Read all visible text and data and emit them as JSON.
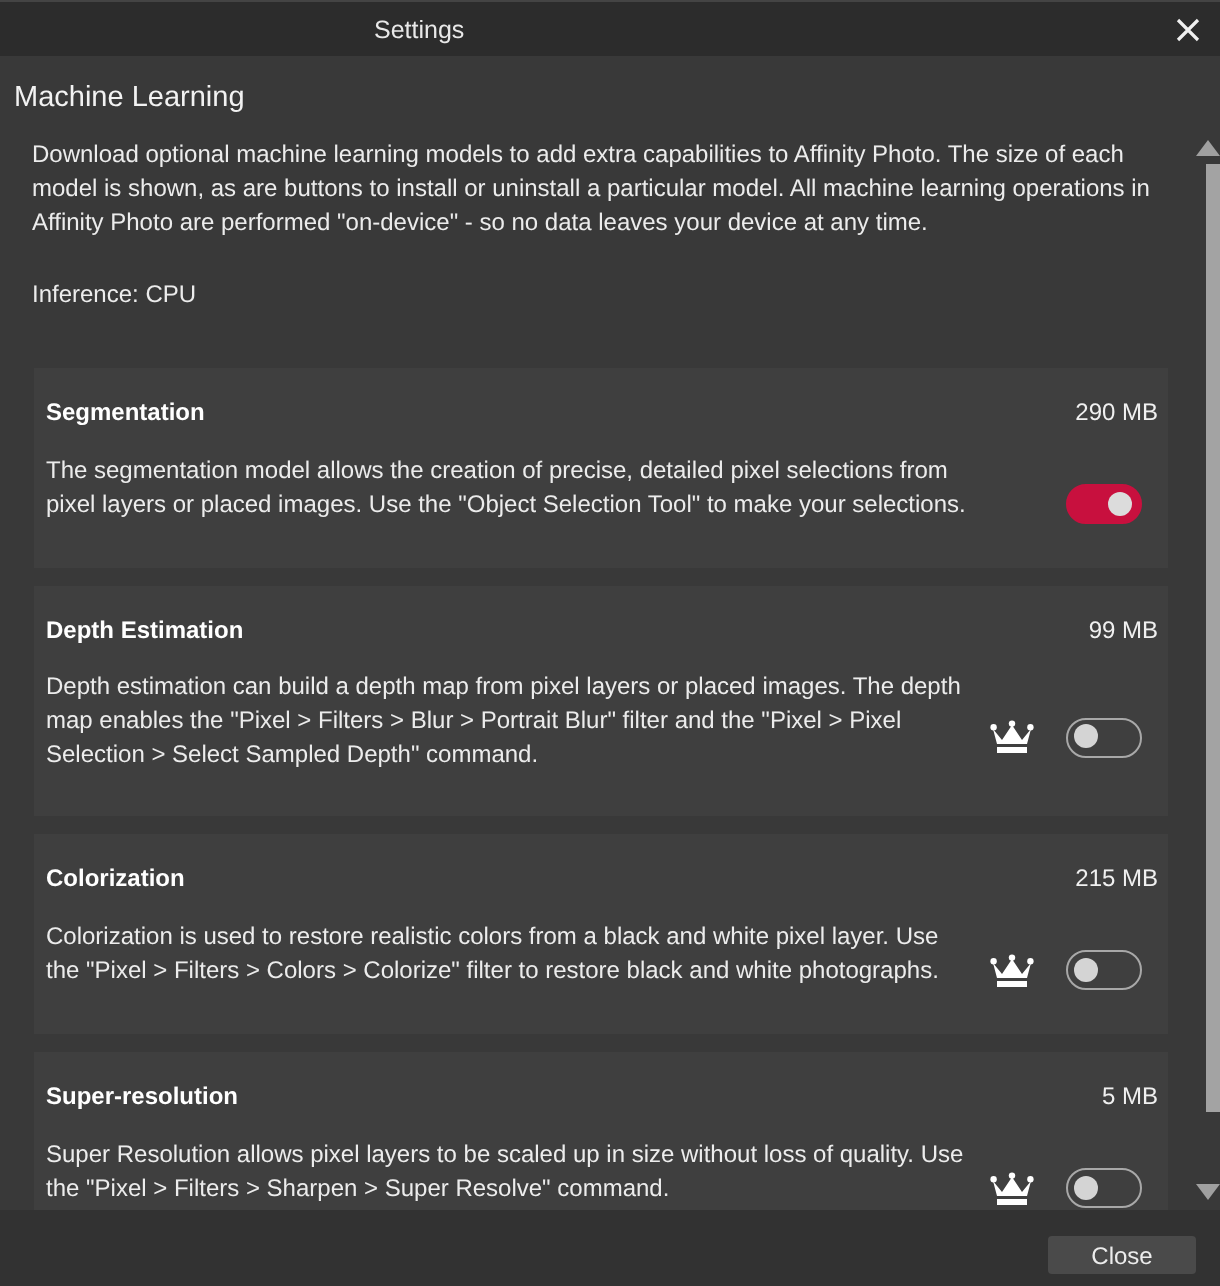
{
  "window": {
    "title": "Settings"
  },
  "section": {
    "heading": "Machine Learning",
    "description": "Download optional machine learning models to add extra capabilities to Affinity Photo. The size of each model is shown, as are buttons to install or uninstall a particular model. All machine learning operations in Affinity Photo are performed \"on-device\" - so no data leaves your device at any time.",
    "inference": "Inference: CPU"
  },
  "models": [
    {
      "name": "Segmentation",
      "size": "290 MB",
      "description": "The segmentation model allows the creation of precise, detailed pixel selections from pixel layers or placed images. Use the \"Object Selection Tool\" to make your selections.",
      "premium": false,
      "on": true
    },
    {
      "name": "Depth Estimation",
      "size": "99 MB",
      "description": "Depth estimation can build a depth map from pixel layers or placed images. The depth map enables the \"Pixel > Filters > Blur > Portrait Blur\" filter and the \"Pixel > Pixel Selection > Select Sampled Depth\" command.",
      "premium": true,
      "on": false
    },
    {
      "name": "Colorization",
      "size": "215 MB",
      "description": "Colorization is used to restore realistic colors from a black and white pixel layer. Use the \"Pixel > Filters > Colors > Colorize\" filter to restore black and white photographs.",
      "premium": true,
      "on": false
    },
    {
      "name": "Super-resolution",
      "size": "5 MB",
      "description": "Super Resolution allows pixel layers to be scaled up in size without loss of quality. Use the \"Pixel > Filters > Sharpen > Super Resolve\" command.",
      "premium": true,
      "on": false
    }
  ],
  "footer": {
    "buttons": [
      "Close"
    ]
  }
}
